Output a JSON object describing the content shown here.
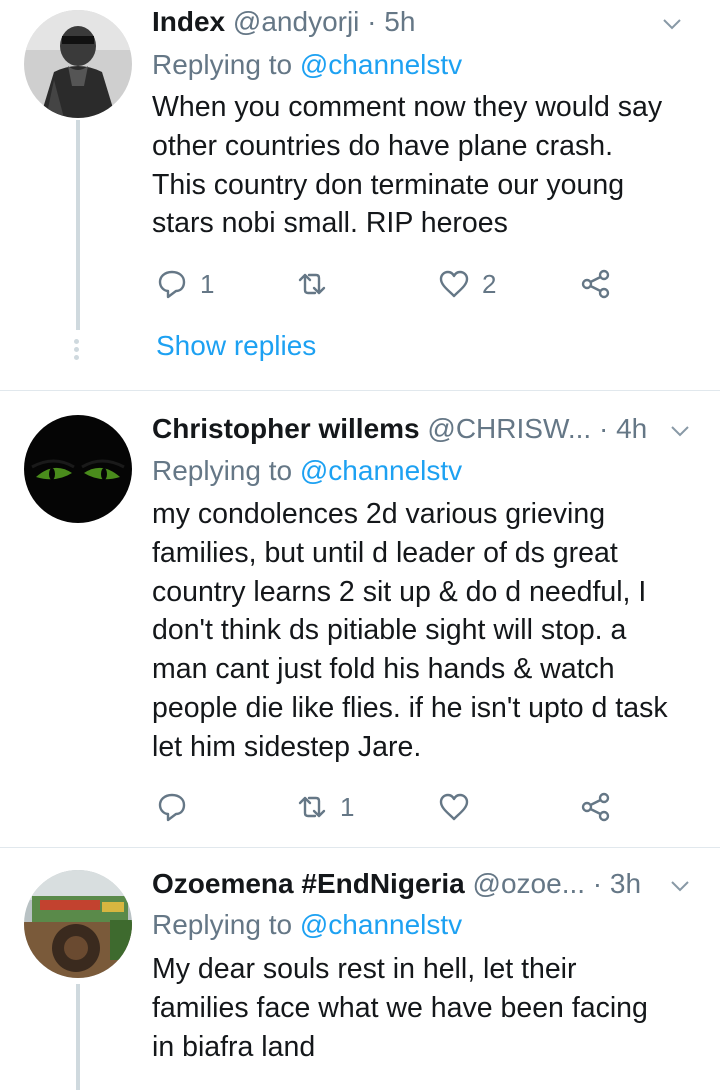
{
  "tweets": [
    {
      "name": "Index",
      "handle": "@andyorji",
      "sep": " · ",
      "time": "5h",
      "replying_prefix": "Replying to ",
      "replying_to": "@channelstv",
      "lines": [
        "When you comment now they would say",
        "other countries do have plane crash.",
        "This country don terminate our young",
        "stars nobi small. RIP heroes"
      ],
      "reply_count": "1",
      "retweet_count": "",
      "like_count": "2",
      "show_replies": "Show replies"
    },
    {
      "name": "Christopher willems",
      "handle": "@CHRISW...",
      "sep": " · ",
      "time": "4h",
      "replying_prefix": "Replying to ",
      "replying_to": "@channelstv",
      "lines": [
        "my condolences 2d various grieving",
        "families,  but until d leader of ds great",
        "country  learns 2 sit up & do d needful,  I",
        "don't think ds pitiable  sight will stop. a",
        "man cant just fold his hands & watch",
        "people  die like flies. if he isn't upto d task",
        "let him sidestep Jare."
      ],
      "reply_count": "",
      "retweet_count": "1",
      "like_count": ""
    },
    {
      "name": "Ozoemena #EndNigeria",
      "handle": "@ozoe...",
      "sep": " · ",
      "time": "3h",
      "replying_prefix": "Replying to ",
      "replying_to": "@channelstv",
      "lines": [
        "My dear souls rest in hell, let their",
        "families face what we have been facing",
        "in biafra land"
      ]
    }
  ],
  "colors": {
    "link": "#1da1f2",
    "secondary": "#657786",
    "thread_line": "#cfd9de",
    "divider": "#e1e8ed"
  },
  "icons": [
    "chevron-down-icon",
    "reply-icon",
    "retweet-icon",
    "like-icon",
    "share-icon"
  ]
}
